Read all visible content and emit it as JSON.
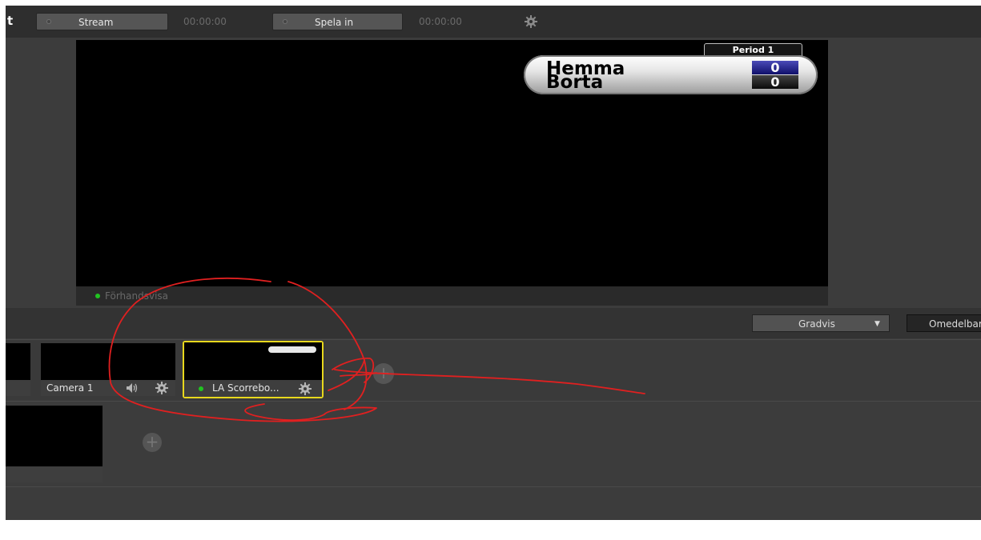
{
  "topbar": {
    "app_title_letter": "t",
    "stream_label": "Stream",
    "stream_timer": "00:00:00",
    "record_label": "Spela in",
    "record_timer": "00:00:00",
    "settings_icon": "gear-icon"
  },
  "preview": {
    "label": "Förhandsvisa",
    "status_color": "#21c321",
    "scoreboard": {
      "period": "Period 1",
      "home_team": "Hemma",
      "away_team": "Borta",
      "home_score": "0",
      "away_score": "0"
    }
  },
  "transition": {
    "mode": "Gradvis",
    "immediate": "Omedelbart"
  },
  "sources": [
    {
      "label": "Camera 1",
      "icons": [
        "speaker-icon",
        "gear-icon"
      ]
    },
    {
      "label": "LA Scorrebo...",
      "selected": true,
      "highlight_color": "#e8d81d",
      "icons": [
        "gear-icon"
      ]
    }
  ],
  "annotation_color": "#e02020"
}
